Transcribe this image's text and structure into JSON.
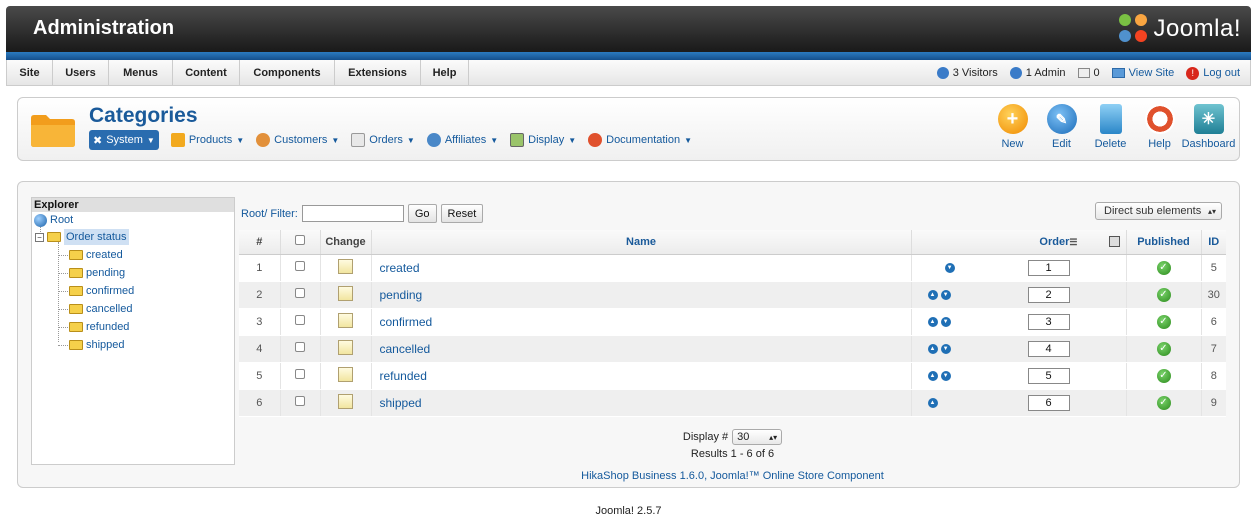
{
  "header": {
    "title": "Administration",
    "logo_text": "Joomla!"
  },
  "menu": {
    "items": [
      "Site",
      "Users",
      "Menus",
      "Content",
      "Components",
      "Extensions",
      "Help"
    ]
  },
  "status": {
    "visitors": "3 Visitors",
    "admin": "1 Admin",
    "messages": "0",
    "view_site": "View Site",
    "logout": "Log out"
  },
  "page": {
    "title": "Categories"
  },
  "submenu": {
    "items": [
      "System",
      "Products",
      "Customers",
      "Orders",
      "Affiliates",
      "Display",
      "Documentation"
    ]
  },
  "toolbar": {
    "new": "New",
    "edit": "Edit",
    "delete": "Delete",
    "help": "Help",
    "dashboard": "Dashboard"
  },
  "explorer": {
    "header": "Explorer",
    "root": "Root",
    "group": "Order status",
    "children": [
      "created",
      "pending",
      "confirmed",
      "cancelled",
      "refunded",
      "shipped"
    ]
  },
  "filter": {
    "prefix": "Root/ Filter:",
    "value": "",
    "go": "Go",
    "reset": "Reset"
  },
  "sub_select": {
    "value": "Direct sub elements"
  },
  "table": {
    "headers": {
      "num": "#",
      "change": "Change",
      "name": "Name",
      "order": "Order",
      "published": "Published",
      "id": "ID"
    },
    "rows": [
      {
        "num": "1",
        "name": "created",
        "order": "1",
        "id": "5",
        "up": false,
        "down": true
      },
      {
        "num": "2",
        "name": "pending",
        "order": "2",
        "id": "30",
        "up": true,
        "down": true
      },
      {
        "num": "3",
        "name": "confirmed",
        "order": "3",
        "id": "6",
        "up": true,
        "down": true
      },
      {
        "num": "4",
        "name": "cancelled",
        "order": "4",
        "id": "7",
        "up": true,
        "down": true
      },
      {
        "num": "5",
        "name": "refunded",
        "order": "5",
        "id": "8",
        "up": true,
        "down": true
      },
      {
        "num": "6",
        "name": "shipped",
        "order": "6",
        "id": "9",
        "up": true,
        "down": false
      }
    ]
  },
  "footer": {
    "display_label": "Display #",
    "display_value": "30",
    "results": "Results 1 - 6 of 6",
    "credit": "HikaShop Business 1.6.0, Joomla!™ Online Store Component"
  },
  "version": "Joomla! 2.5.7"
}
